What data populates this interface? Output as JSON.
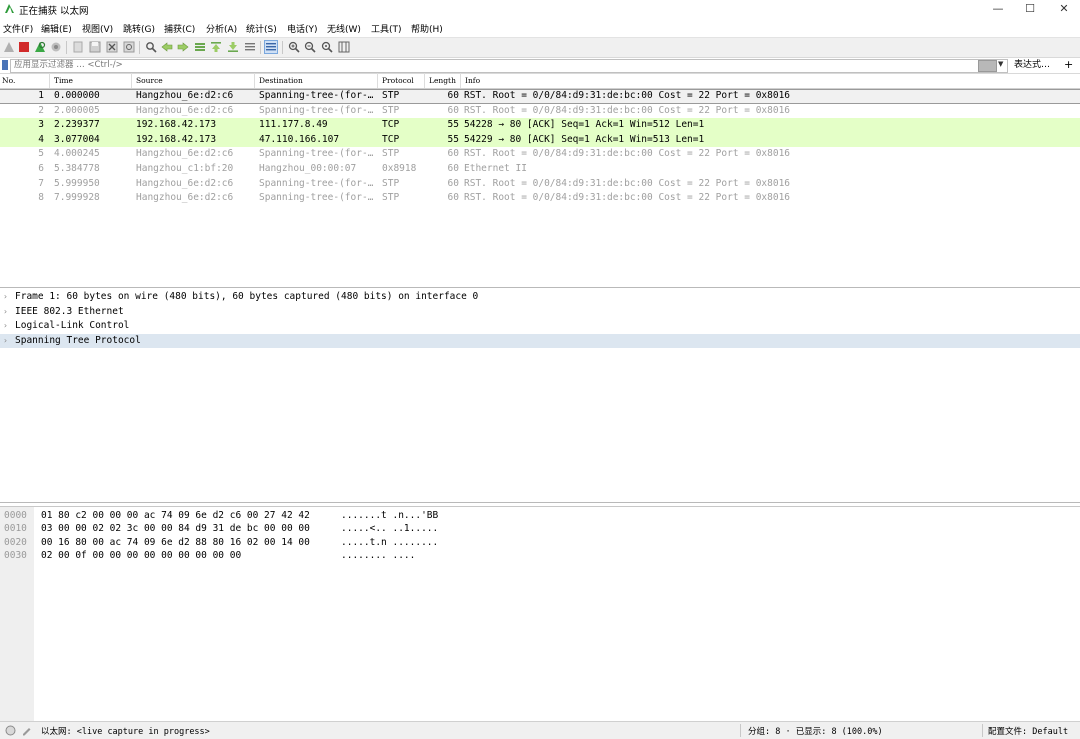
{
  "window": {
    "title": "正在捕获 以太网",
    "minimize": "—",
    "maximize": "☐",
    "close": "✕"
  },
  "menu": [
    "文件(F)",
    "编辑(E)",
    "视图(V)",
    "跳转(G)",
    "捕获(C)",
    "分析(A)",
    "统计(S)",
    "电话(Y)",
    "无线(W)",
    "工具(T)",
    "帮助(H)"
  ],
  "filter": {
    "placeholder": "应用显示过滤器 … <Ctrl-/>",
    "expression_label": "表达式…",
    "add_label": "+"
  },
  "columns": [
    "No.",
    "Time",
    "Source",
    "Destination",
    "Protocol",
    "Length",
    "Info"
  ],
  "packets": [
    {
      "no": "1",
      "time": "0.000000",
      "source": "Hangzhou_6e:d2:c6",
      "destination": "Spanning-tree-(for-…",
      "protocol": "STP",
      "length": "60",
      "info": "RST. Root = 0/0/84:d9:31:de:bc:00  Cost = 22  Port = 0x8016",
      "style": "sel"
    },
    {
      "no": "2",
      "time": "2.000005",
      "source": "Hangzhou_6e:d2:c6",
      "destination": "Spanning-tree-(for-…",
      "protocol": "STP",
      "length": "60",
      "info": "RST. Root = 0/0/84:d9:31:de:bc:00  Cost = 22  Port = 0x8016",
      "style": "grey"
    },
    {
      "no": "3",
      "time": "2.239377",
      "source": "192.168.42.173",
      "destination": "111.177.8.49",
      "protocol": "TCP",
      "length": "55",
      "info": "54228 → 80 [ACK] Seq=1 Ack=1 Win=512 Len=1",
      "style": "tcp"
    },
    {
      "no": "4",
      "time": "3.077004",
      "source": "192.168.42.173",
      "destination": "47.110.166.107",
      "protocol": "TCP",
      "length": "55",
      "info": "54229 → 80 [ACK] Seq=1 Ack=1 Win=513 Len=1",
      "style": "tcp"
    },
    {
      "no": "5",
      "time": "4.000245",
      "source": "Hangzhou_6e:d2:c6",
      "destination": "Spanning-tree-(for-…",
      "protocol": "STP",
      "length": "60",
      "info": "RST. Root = 0/0/84:d9:31:de:bc:00  Cost = 22  Port = 0x8016",
      "style": "grey"
    },
    {
      "no": "6",
      "time": "5.384778",
      "source": "Hangzhou_c1:bf:20",
      "destination": "Hangzhou_00:00:07",
      "protocol": "0x8918",
      "length": "60",
      "info": "Ethernet II",
      "style": "grey"
    },
    {
      "no": "7",
      "time": "5.999950",
      "source": "Hangzhou_6e:d2:c6",
      "destination": "Spanning-tree-(for-…",
      "protocol": "STP",
      "length": "60",
      "info": "RST. Root = 0/0/84:d9:31:de:bc:00  Cost = 22  Port = 0x8016",
      "style": "grey"
    },
    {
      "no": "8",
      "time": "7.999928",
      "source": "Hangzhou_6e:d2:c6",
      "destination": "Spanning-tree-(for-…",
      "protocol": "STP",
      "length": "60",
      "info": "RST. Root = 0/0/84:d9:31:de:bc:00  Cost = 22  Port = 0x8016",
      "style": "grey"
    }
  ],
  "details": [
    {
      "text": "Frame 1: 60 bytes on wire (480 bits), 60 bytes captured (480 bits) on interface 0",
      "highlight": false
    },
    {
      "text": "IEEE 802.3 Ethernet",
      "highlight": false
    },
    {
      "text": "Logical-Link Control",
      "highlight": false
    },
    {
      "text": "Spanning Tree Protocol",
      "highlight": true
    }
  ],
  "bytes": [
    {
      "offset": "0000",
      "hex": "01 80 c2 00 00 00 ac 74  09 6e d2 c6 00 27 42 42",
      "ascii": ".......t .n...'BB"
    },
    {
      "offset": "0010",
      "hex": "03 00 00 02 02 3c 00 00  84 d9 31 de bc 00 00 00",
      "ascii": ".....<.. ..1....."
    },
    {
      "offset": "0020",
      "hex": "00 16 80 00 ac 74 09 6e  d2 88 80 16 02 00 14 00",
      "ascii": ".....t.n ........"
    },
    {
      "offset": "0030",
      "hex": "02 00 0f 00 00 00 00 00  00 00 00 00",
      "ascii": "........ ...."
    }
  ],
  "status": {
    "capture_text": "以太网: <live capture in progress>",
    "packets_text": "分组: 8 · 已显示: 8 (100.0%)",
    "profile_text": "配置文件: Default"
  },
  "colors": {
    "tcp_row": "#e4ffc7",
    "selected_detail": "#dce6f0",
    "accent": "#4a74b8"
  }
}
